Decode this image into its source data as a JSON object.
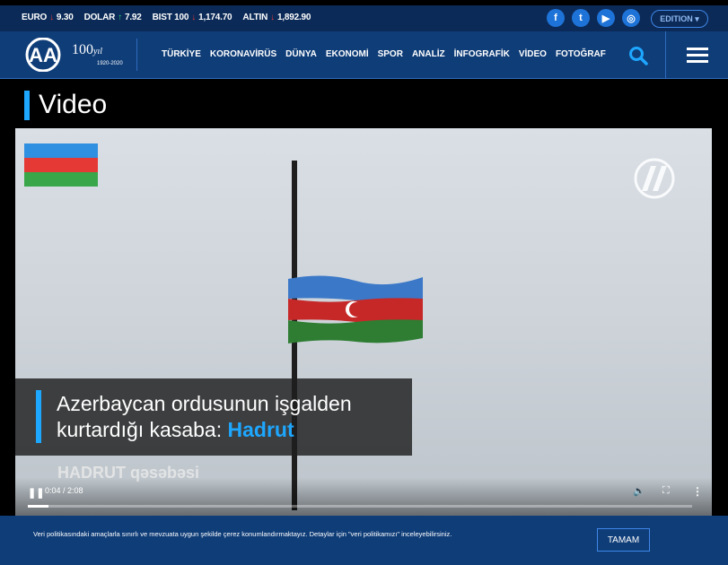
{
  "ticker": [
    {
      "label": "EURO",
      "arrow": "↓",
      "value": "9.30",
      "dir": "down"
    },
    {
      "label": "DOLAR",
      "arrow": "↑",
      "value": "7.92",
      "dir": "up"
    },
    {
      "label": "BIST 100",
      "arrow": "↓",
      "value": "1,174.70",
      "dir": "down"
    },
    {
      "label": "ALTIN",
      "arrow": "↓",
      "value": "1,892.90",
      "dir": "down"
    }
  ],
  "social": [
    "f",
    "t",
    "▶",
    "◎"
  ],
  "edition_label": "EDITION ▾",
  "logo_text": "AA",
  "centennial": {
    "main": "100",
    "suffix": "yıl",
    "years": "1920-2020"
  },
  "nav": [
    "TÜRKİYE",
    "KORONAVİRÜS",
    "DÜNYA",
    "EKONOMİ",
    "SPOR",
    "ANALİZ",
    "İNFOGRAFİK",
    "VİDEO",
    "FOTOĞRAF"
  ],
  "page_title": "Video",
  "video": {
    "headline_line1": "Azerbaycan ordusunun işgalden",
    "headline_line2_prefix": "kurtardığı kasaba: ",
    "headline_highlight": "Hadrut",
    "subtitle": "HADRUT qəsəbəsi",
    "time": "0:04 / 2:08",
    "progress": 0.031
  },
  "cookie": {
    "text": "Veri politikasındaki amaçlarla sınırlı ve mevzuata uygun şekilde çerez konumlandırmaktayız. Detaylar için \"veri politikamızı\" inceleyebilirsiniz.",
    "button": "TAMAM"
  },
  "colors": {
    "navy": "#0f3d78",
    "accent": "#1ea7ff"
  }
}
